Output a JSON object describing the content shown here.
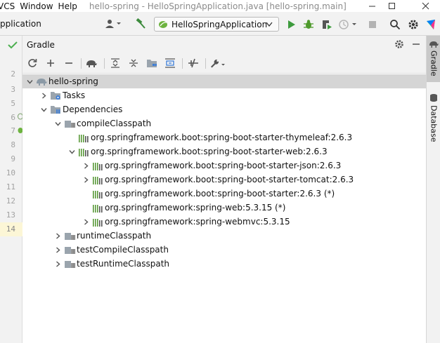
{
  "menu": {
    "vcs": "VCS",
    "window": "Window",
    "help": "Help"
  },
  "window": {
    "title": "hello-spring - HelloSpringApplication.java [hello-spring.main]"
  },
  "navbar": {
    "breadcrumb": "pplication",
    "run_config": "HelloSpringApplication"
  },
  "gutter": {
    "lines": [
      "2",
      "3",
      "5",
      "6",
      "7",
      "8",
      "9",
      "10",
      "11",
      "12",
      "13",
      "14"
    ]
  },
  "panel": {
    "title": "Gradle"
  },
  "tree": {
    "root": "hello-spring",
    "tasks": "Tasks",
    "dependencies": "Dependencies",
    "compile_classpath": "compileClasspath",
    "thymeleaf": "org.springframework.boot:spring-boot-starter-thymeleaf:2.6.3",
    "web": "org.springframework.boot:spring-boot-starter-web:2.6.3",
    "json": "org.springframework.boot:spring-boot-starter-json:2.6.3",
    "tomcat": "org.springframework.boot:spring-boot-starter-tomcat:2.6.3",
    "starter": "org.springframework.boot:spring-boot-starter:2.6.3 (*)",
    "spring_web": "org.springframework:spring-web:5.3.15 (*)",
    "webmvc": "org.springframework:spring-webmvc:5.3.15",
    "runtime_classpath": "runtimeClasspath",
    "test_compile_classpath": "testCompileClasspath",
    "test_runtime_classpath": "testRuntimeClasspath"
  },
  "rightbar": {
    "gradle_tab": "Gradle",
    "database_tab": "Database"
  },
  "colors": {
    "run_green": "#3d9b3d",
    "debug_green": "#4f9a2c",
    "library_green": "#5a9a3a",
    "folder_gray": "#9aa4ad",
    "elephant_gray": "#8c9aa6"
  }
}
